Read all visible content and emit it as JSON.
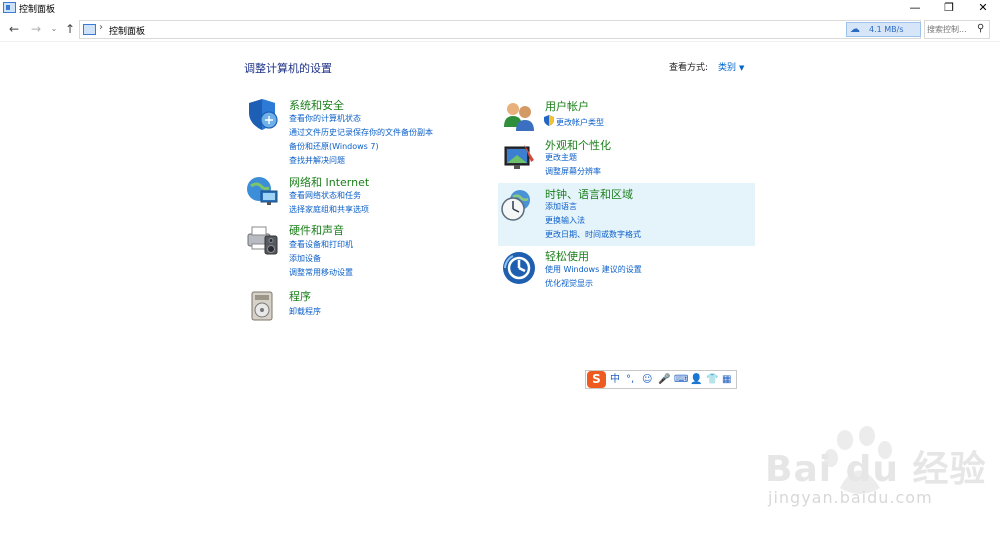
{
  "window": {
    "title": "控制面板",
    "min_glyph": "—",
    "max_glyph": "❐",
    "close_glyph": "✕"
  },
  "nav": {
    "back_glyph": "←",
    "forward_glyph": "→",
    "dropdown_glyph": "⌄",
    "up_glyph": "↑",
    "separator": "›",
    "breadcrumb": "控制面板",
    "speed_text": "4.1 MB/s",
    "search_placeholder": "搜索控制..."
  },
  "main": {
    "title": "调整计算机的设置",
    "view_label": "查看方式:",
    "view_value": "类别",
    "view_arrow": "▼"
  },
  "categories": [
    {
      "title": "系统和安全",
      "icon": "shield-icon",
      "links": [
        "查看你的计算机状态",
        "通过文件历史记录保存你的文件备份副本",
        "备份和还原(Windows 7)",
        "查找并解决问题"
      ]
    },
    {
      "title": "网络和 Internet",
      "icon": "network-globe-icon",
      "links": [
        "查看网络状态和任务",
        "选择家庭组和共享选项"
      ]
    },
    {
      "title": "硬件和声音",
      "icon": "printer-speaker-icon",
      "links": [
        "查看设备和打印机",
        "添加设备",
        "调整常用移动设置"
      ]
    },
    {
      "title": "程序",
      "icon": "programs-icon",
      "links": [
        "卸载程序"
      ]
    },
    {
      "title": "用户帐户",
      "icon": "users-icon",
      "links": [
        "更改帐户类型"
      ]
    },
    {
      "title": "外观和个性化",
      "icon": "display-brush-icon",
      "links": [
        "更改主题",
        "调整屏幕分辨率"
      ]
    },
    {
      "title": "时钟、语言和区域",
      "icon": "clock-globe-icon",
      "links": [
        "添加语言",
        "更换输入法",
        "更改日期、时间或数字格式"
      ]
    },
    {
      "title": "轻松使用",
      "icon": "ease-of-access-icon",
      "links": [
        "使用 Windows 建议的设置",
        "优化视觉显示"
      ]
    }
  ],
  "ime": {
    "logo": "S",
    "items": [
      "中",
      "°,",
      "☺",
      "🎤",
      "⌨",
      "👤",
      "👕",
      "▦"
    ]
  },
  "watermark": {
    "brand": "Bai  du 经验",
    "url": "jingyan.baidu.com"
  },
  "colors": {
    "title_blue": "#1e3287",
    "category_green": "#1a7f1a",
    "link_blue": "#0b5fc8",
    "hover_bg": "#e5f3fb"
  }
}
